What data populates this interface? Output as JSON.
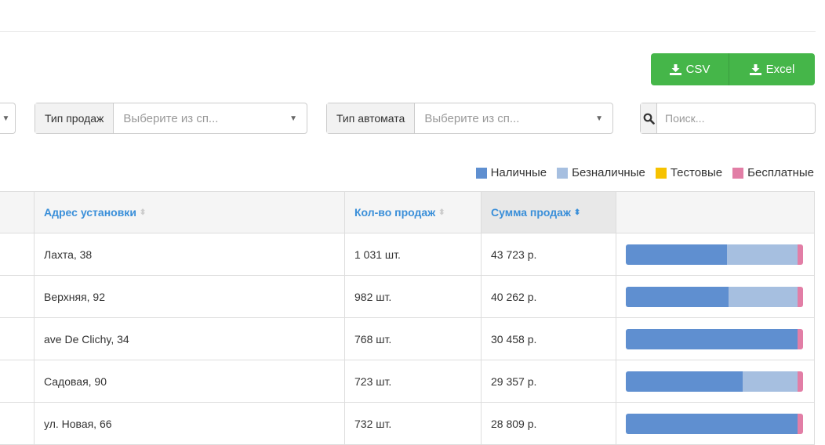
{
  "colors": {
    "cash": "#5f8fd0",
    "cashless": "#a6bfe0",
    "test": "#f6c200",
    "free": "#e27ea6",
    "accent_green": "#45b649",
    "link_blue": "#3a8fd9"
  },
  "export": {
    "csv_label": "CSV",
    "excel_label": "Excel",
    "icon": "download-icon"
  },
  "filters": {
    "sales_type": {
      "label": "Тип продаж",
      "value": "Выберите из сп..."
    },
    "machine_type": {
      "label": "Тип автомата",
      "value": "Выберите из сп..."
    }
  },
  "search": {
    "placeholder": "Поиск...",
    "icon": "search-icon"
  },
  "legend": [
    {
      "label": "Наличные",
      "color": "#5f8fd0"
    },
    {
      "label": "Безналичные",
      "color": "#a6bfe0"
    },
    {
      "label": "Тестовые",
      "color": "#f6c200"
    },
    {
      "label": "Бесплатные",
      "color": "#e27ea6"
    }
  ],
  "table": {
    "columns": {
      "address": "Адрес установки",
      "count": "Кол-во продаж",
      "sum": "Сумма продаж"
    },
    "rows": [
      {
        "address": "Лахта, 38",
        "count": "1 031 шт.",
        "sum": "43 723 р.",
        "split": {
          "cash": 0.57,
          "cashless": 0.4,
          "test": 0.0,
          "free": 0.03
        }
      },
      {
        "address": "Верхняя, 92",
        "count": "982 шт.",
        "sum": "40 262 р.",
        "split": {
          "cash": 0.58,
          "cashless": 0.39,
          "test": 0.0,
          "free": 0.03
        }
      },
      {
        "address": "ave De Clichy, 34",
        "count": "768 шт.",
        "sum": "30 458 р.",
        "split": {
          "cash": 0.97,
          "cashless": 0.0,
          "test": 0.0,
          "free": 0.03
        }
      },
      {
        "address": "Садовая, 90",
        "count": "723 шт.",
        "sum": "29 357 р.",
        "split": {
          "cash": 0.66,
          "cashless": 0.31,
          "test": 0.0,
          "free": 0.03
        }
      },
      {
        "address": "ул. Новая, 66",
        "count": "732 шт.",
        "sum": "28 809 р.",
        "split": {
          "cash": 0.97,
          "cashless": 0.0,
          "test": 0.0,
          "free": 0.03
        }
      }
    ]
  }
}
